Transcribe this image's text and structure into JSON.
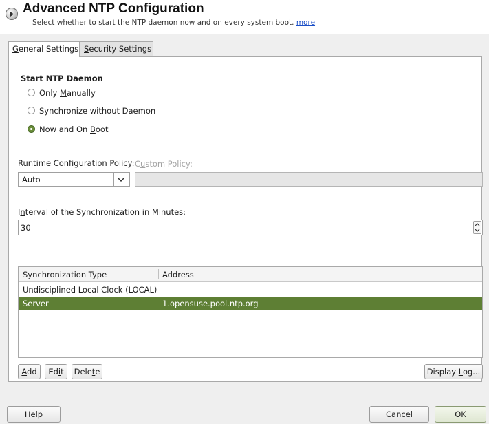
{
  "header": {
    "title": "Advanced NTP Configuration",
    "subtitle": "Select whether to start the NTP daemon now and on every system boot.",
    "more_link": "more"
  },
  "tabs": [
    {
      "pre": "",
      "mnemonic": "G",
      "post": "eneral Settings",
      "active": true
    },
    {
      "pre": "",
      "mnemonic": "S",
      "post": "ecurity Settings",
      "active": false
    }
  ],
  "start_daemon": {
    "heading": "Start NTP Daemon",
    "options": [
      {
        "pre": "Only ",
        "mnemonic": "M",
        "post": "anually",
        "checked": false
      },
      {
        "pre": "Synchronize without Daemon",
        "mnemonic": "",
        "post": "",
        "checked": false
      },
      {
        "pre": "Now and On ",
        "mnemonic": "B",
        "post": "oot",
        "checked": true
      }
    ]
  },
  "runtime_policy": {
    "label_mnemonic": "R",
    "label_rest": "untime Configuration Policy:",
    "value": "Auto",
    "custom_label_pre": "C",
    "custom_label_mnemonic": "u",
    "custom_label_post": "stom Policy:",
    "custom_value": ""
  },
  "interval": {
    "label_pre": "I",
    "label_mnemonic": "n",
    "label_post": "terval of the Synchronization in Minutes:",
    "value": "30"
  },
  "sync_table": {
    "columns": [
      "Synchronization Type",
      "Address"
    ],
    "rows": [
      {
        "type": "Undisciplined Local Clock (LOCAL)",
        "address": "",
        "selected": false
      },
      {
        "type": "Server",
        "address": "1.opensuse.pool.ntp.org",
        "selected": true
      }
    ]
  },
  "table_buttons": {
    "add": {
      "mnemonic": "A",
      "rest": "dd"
    },
    "edit": {
      "pre": "Ed",
      "mnemonic": "i",
      "post": "t"
    },
    "delete": {
      "pre": "Dele",
      "mnemonic": "t",
      "post": "e"
    },
    "display_log": {
      "pre": "Display ",
      "mnemonic": "L",
      "post": "og..."
    }
  },
  "footer": {
    "help": "Help",
    "cancel": {
      "mnemonic": "C",
      "rest": "ancel"
    },
    "ok": {
      "mnemonic": "O",
      "rest": "K"
    }
  },
  "colors": {
    "selection": "#5e7f34",
    "radio_checked": "#6b8e3a",
    "link": "#1a4ec7"
  }
}
